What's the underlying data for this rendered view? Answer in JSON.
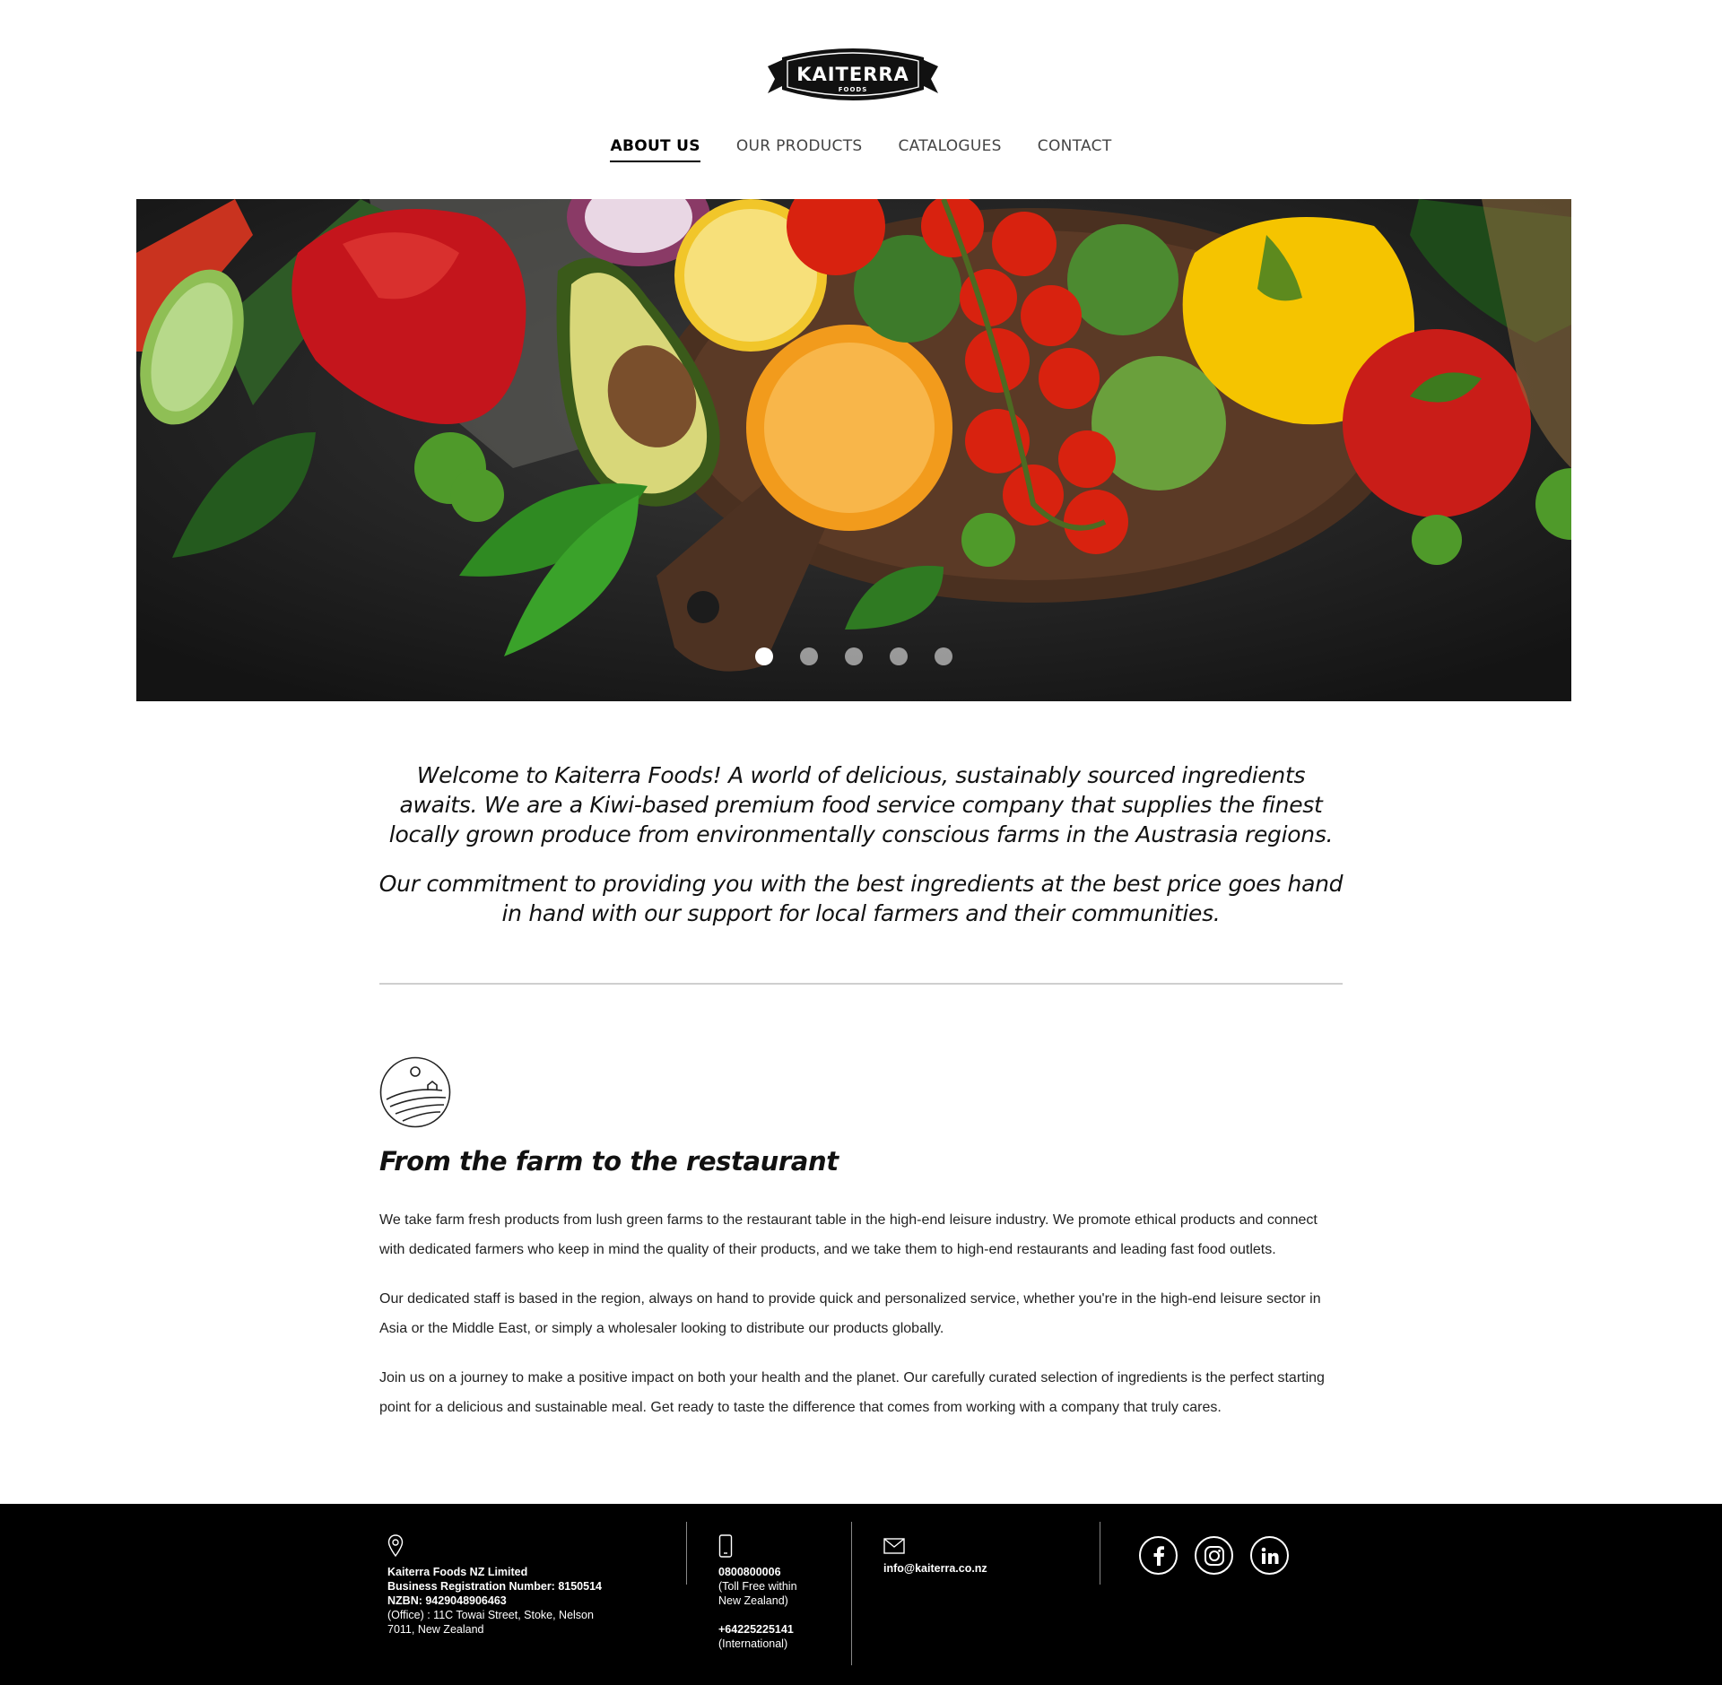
{
  "brand": {
    "logo_main": "KAITERRA",
    "logo_sub": "FOODS"
  },
  "nav": {
    "items": [
      {
        "label": "ABOUT US",
        "active": true
      },
      {
        "label": "OUR PRODUCTS",
        "active": false
      },
      {
        "label": "CATALOGUES",
        "active": false
      },
      {
        "label": "CONTACT",
        "active": false
      }
    ]
  },
  "hero": {
    "slide_count": 5,
    "active_slide": 1
  },
  "intro": {
    "paragraph1": "Welcome to Kaiterra Foods! A world of delicious, sustainably sourced ingredients awaits. We are a Kiwi-based premium food service company that supplies the finest locally grown produce from environmentally conscious farms in the Austrasia regions.",
    "paragraph2": "Our commitment to providing you with the best ingredients at the best price goes hand in hand with our support for local farmers and their communities."
  },
  "farm_section": {
    "icon": "farm-landscape-icon",
    "title": "From the farm to the restaurant",
    "paragraphs": [
      "We take farm fresh products from lush green farms to the restaurant table in the high-end leisure industry. We promote ethical products and connect with dedicated farmers who keep in mind the quality of their products, and we take them to high-end restaurants and leading fast food outlets.",
      "Our dedicated staff is based in the region, always on hand to provide quick and personalized service, whether you're in the high-end leisure sector in Asia or the Middle East, or simply a wholesaler looking to distribute our products globally.",
      "Join us on a journey to make a positive impact on both your health and the planet. Our carefully curated selection of ingredients is the perfect starting point for a delicious and sustainable meal. Get ready to taste the difference that comes from working with a company that truly cares."
    ]
  },
  "footer": {
    "address": {
      "icon": "location-pin-icon",
      "company": "Kaiterra Foods NZ Limited",
      "registration": "Business Registration Number: 8150514",
      "nzbn": "NZBN: 9429048906463",
      "office_line1": "(Office) : 11C Towai Street, Stoke, Nelson",
      "office_line2": "7011, New Zealand"
    },
    "phone": {
      "icon": "mobile-phone-icon",
      "tollfree_number": "0800800006",
      "tollfree_note_1": "(Toll Free within",
      "tollfree_note_2": "New Zealand)",
      "intl_number": "+64225225141",
      "intl_note": "(International)"
    },
    "email": {
      "icon": "envelope-icon",
      "address": "info@kaiterra.co.nz"
    },
    "social": [
      "facebook-icon",
      "instagram-icon",
      "linkedin-icon"
    ]
  }
}
